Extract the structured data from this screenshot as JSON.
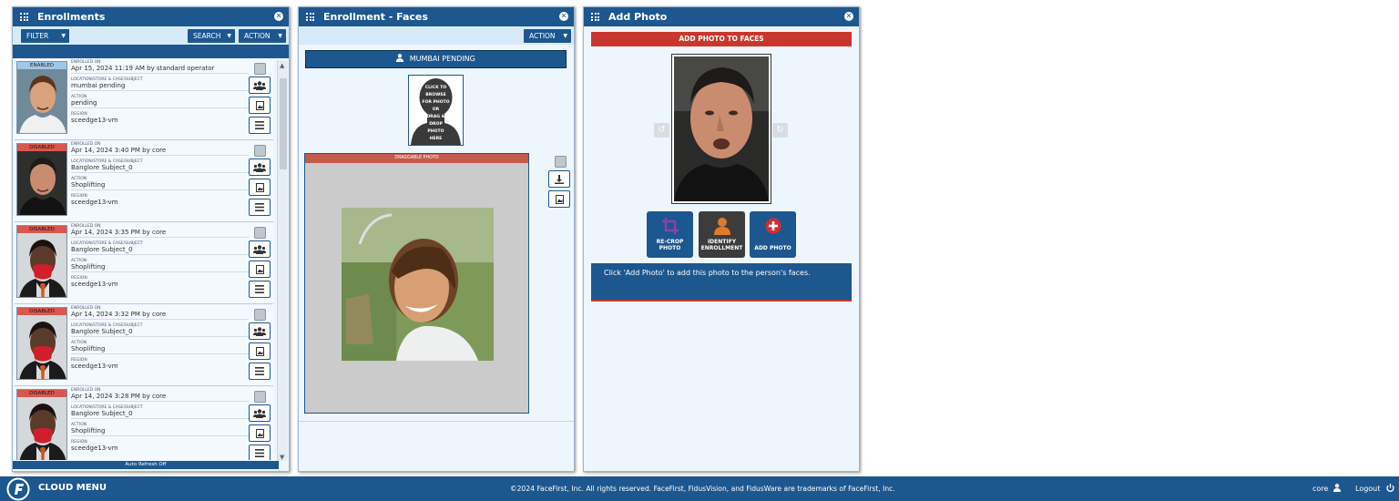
{
  "enrollments": {
    "title": "Enrollments",
    "filter_label": "FILTER",
    "search_label": "SEARCH",
    "action_label": "ACTION",
    "auto_refresh": "Auto Refresh Off",
    "field_labels": {
      "enrolled_on": "ENROLLED ON",
      "location": "LOCATION/STORE & CASE/SUBJECT",
      "action": "ACTION",
      "region": "REGION"
    },
    "items": [
      {
        "status": "ENABLED",
        "enrolled_on": "Apr 15, 2024 11:19 AM by standard operator",
        "location": "mumbai pending",
        "action": "pending",
        "region": "sceedge13-vm"
      },
      {
        "status": "DISABLED",
        "enrolled_on": "Apr 14, 2024 3:40 PM by core",
        "location": "Banglore Subject_0",
        "action": "Shoplifting",
        "region": "sceedge13-vm"
      },
      {
        "status": "DISABLED",
        "enrolled_on": "Apr 14, 2024 3:35 PM by core",
        "location": "Banglore Subject_0",
        "action": "Shoplifting",
        "region": "sceedge13-vm"
      },
      {
        "status": "DISABLED",
        "enrolled_on": "Apr 14, 2024 3:32 PM by core",
        "location": "Banglore Subject_0",
        "action": "Shoplifting",
        "region": "sceedge13-vm"
      },
      {
        "status": "DISABLED",
        "enrolled_on": "Apr 14, 2024 3:28 PM by core",
        "location": "Banglore Subject_0",
        "action": "Shoplifting",
        "region": "sceedge13-vm"
      }
    ]
  },
  "faces": {
    "title": "Enrollment - Faces",
    "action_label": "ACTION",
    "person_button": "MUMBAI PENDING",
    "drop_text": [
      "CLICK TO",
      "BROWSE",
      "FOR PHOTO",
      "OR",
      "DRAG &",
      "DROP",
      "PHOTO",
      "HERE"
    ],
    "draggable_label": "DRAGGABLE PHOTO"
  },
  "add_photo": {
    "title": "Add Photo",
    "banner": "ADD PHOTO TO FACES",
    "recrop_label": [
      "RE-CROP",
      "PHOTO"
    ],
    "identify_label": [
      "IDENTIFY",
      "ENROLLMENT"
    ],
    "add_label": "ADD PHOTO",
    "info_text": "Click 'Add Photo' to add this photo to the person's faces."
  },
  "footer": {
    "menu_label": "CLOUD MENU",
    "copyright": "©2024 FaceFirst, Inc. All rights reserved. FaceFirst, FidusVision, and FidusWare are trademarks of FaceFirst, Inc.",
    "user": "core",
    "logout": "Logout"
  },
  "colors": {
    "brand": "#1c5790",
    "banner_red": "#c9372c",
    "panel_bg": "#eef6fd"
  },
  "icons": [
    "grid-icon",
    "close-icon",
    "person-icon",
    "people-icon",
    "photo-icon",
    "list-icon",
    "download-icon",
    "rotate-left-icon",
    "rotate-right-icon",
    "crop-icon",
    "plus-circle-icon",
    "power-icon"
  ]
}
